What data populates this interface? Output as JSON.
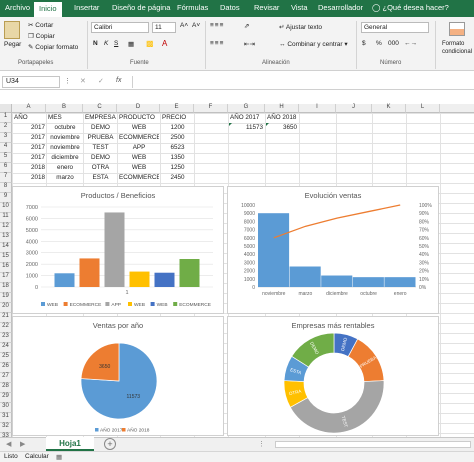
{
  "tabs": [
    "Archivo",
    "Inicio",
    "Insertar",
    "Diseño de página",
    "Fórmulas",
    "Datos",
    "Revisar",
    "Vista",
    "Desarrollador"
  ],
  "tell_me": "¿Qué desea hacer?",
  "ribbon": {
    "paste": "Pegar",
    "cut": "Cortar",
    "copy": "Copiar",
    "copy_format": "Copiar formato",
    "font_name": "Calibri",
    "font_size": "11",
    "bold": "N",
    "italic": "K",
    "underline": "S",
    "wrap_text": "Ajustar texto",
    "merge_center": "Combinar y centrar",
    "number_format": "General",
    "currency": "$",
    "percent": "%",
    "thousands": "000",
    "cond_format": "Formato condicional"
  },
  "groups": {
    "clipboard": "Portapapeles",
    "font": "Fuente",
    "alignment": "Alineación",
    "number": "Número"
  },
  "namebox": "U34",
  "fx": "fx",
  "columns": [
    "A",
    "B",
    "C",
    "D",
    "E",
    "F",
    "G",
    "H",
    "I",
    "J",
    "K",
    "L"
  ],
  "rows": [
    "1",
    "2",
    "3",
    "4",
    "5",
    "6",
    "7",
    "8",
    "9",
    "10",
    "11",
    "12",
    "13",
    "14",
    "15",
    "16",
    "17",
    "18",
    "19",
    "20",
    "21",
    "22",
    "23",
    "24",
    "25",
    "26",
    "27",
    "28",
    "29",
    "30",
    "31",
    "32",
    "33",
    "34"
  ],
  "table": {
    "headers": [
      "AÑO",
      "MES",
      "EMPRESA",
      "PRODUCTO",
      "PRECIO"
    ],
    "rows": [
      [
        "2017",
        "octubre",
        "DEMO",
        "WEB",
        "1200"
      ],
      [
        "2017",
        "noviembre",
        "PRUEBA",
        "ECOMMERCE",
        "2500"
      ],
      [
        "2017",
        "noviembre",
        "TEST",
        "APP",
        "6523"
      ],
      [
        "2017",
        "diciembre",
        "DEMO",
        "WEB",
        "1350"
      ],
      [
        "2018",
        "enero",
        "OTRA",
        "WEB",
        "1250"
      ],
      [
        "2018",
        "marzo",
        "ESTA",
        "ECOMMERCE",
        "2450"
      ]
    ]
  },
  "summary": {
    "headers": [
      "AÑO 2017",
      "AÑO 2018"
    ],
    "values": [
      "11573",
      "3650"
    ]
  },
  "colors": {
    "excel_green": "#217346",
    "blue": "#5b9bd5",
    "orange": "#ed7d31",
    "gray": "#a5a5a5",
    "yellow": "#ffc000",
    "green": "#70ad47",
    "navy": "#4472c4"
  },
  "chart_data": [
    {
      "type": "bar",
      "title": "Productos / Beneficios",
      "categories": [
        "1"
      ],
      "series": [
        {
          "name": "WEB",
          "values": [
            1200
          ],
          "color": "#5b9bd5"
        },
        {
          "name": "ECOMMERCE",
          "values": [
            2500
          ],
          "color": "#ed7d31"
        },
        {
          "name": "APP",
          "values": [
            6523
          ],
          "color": "#a5a5a5"
        },
        {
          "name": "WEB",
          "values": [
            1350
          ],
          "color": "#ffc000"
        },
        {
          "name": "WEB",
          "values": [
            1250
          ],
          "color": "#4472c4"
        },
        {
          "name": "ECOMMERCE",
          "values": [
            2450
          ],
          "color": "#70ad47"
        }
      ],
      "yticks": [
        "0",
        "1000",
        "2000",
        "3000",
        "4000",
        "5000",
        "6000",
        "7000"
      ],
      "ylim": [
        0,
        7000
      ],
      "grid": true,
      "legend": "bottom"
    },
    {
      "type": "bar",
      "title": "Evolución ventas",
      "categories": [
        "noviembre",
        "marzo",
        "diciembre",
        "octubre",
        "enero"
      ],
      "values": [
        9000,
        2500,
        1400,
        1200,
        1200
      ],
      "line_values": [
        60,
        74,
        84,
        92,
        100
      ],
      "yticks": [
        "0",
        "1000",
        "2000",
        "3000",
        "4000",
        "5000",
        "6000",
        "7000",
        "8000",
        "9000",
        "10000"
      ],
      "y2ticks": [
        "0%",
        "10%",
        "20%",
        "30%",
        "40%",
        "50%",
        "60%",
        "70%",
        "80%",
        "90%",
        "100%"
      ],
      "ylim": [
        0,
        10000
      ],
      "y2lim": [
        0,
        100
      ]
    },
    {
      "type": "pie",
      "title": "Ventas por año",
      "labels": [
        "AÑO 2017",
        "AÑO 2018"
      ],
      "values": [
        11573,
        3650
      ],
      "legend": "bottom"
    },
    {
      "type": "pie",
      "title": "Empresas más rentables",
      "labels": [
        "DEMO",
        "PRUEBA",
        "TEST",
        "OTRA",
        "ESTA",
        "DEMO"
      ],
      "values": [
        1200,
        2500,
        6523,
        1350,
        1250,
        2450
      ]
    }
  ],
  "sheet_tab": "Hoja1",
  "status": {
    "ready": "Listo",
    "calc": "Calcular"
  }
}
